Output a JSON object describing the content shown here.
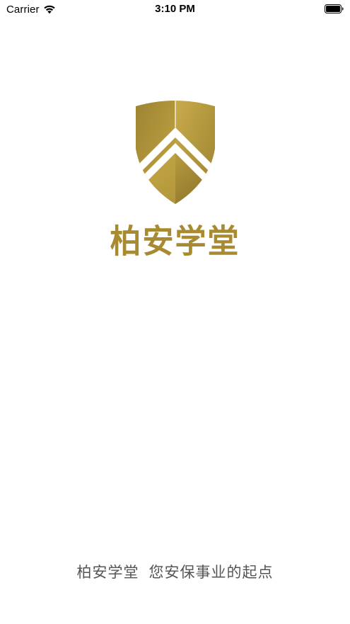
{
  "status_bar": {
    "carrier": "Carrier",
    "time": "3:10 PM",
    "wifi_icon": "wifi-icon",
    "battery_icon": "battery-full-icon"
  },
  "splash": {
    "logo_icon": "shield-chevron-logo-icon",
    "brand_name": "柏安学堂",
    "tagline_name": "柏安学堂",
    "tagline_slogan": "您安保事业的起点"
  },
  "colors": {
    "gold": "#a88a30",
    "gold_light": "#c9ab45",
    "gold_dark": "#8a7128",
    "tagline_text": "#555555",
    "background": "#ffffff"
  }
}
